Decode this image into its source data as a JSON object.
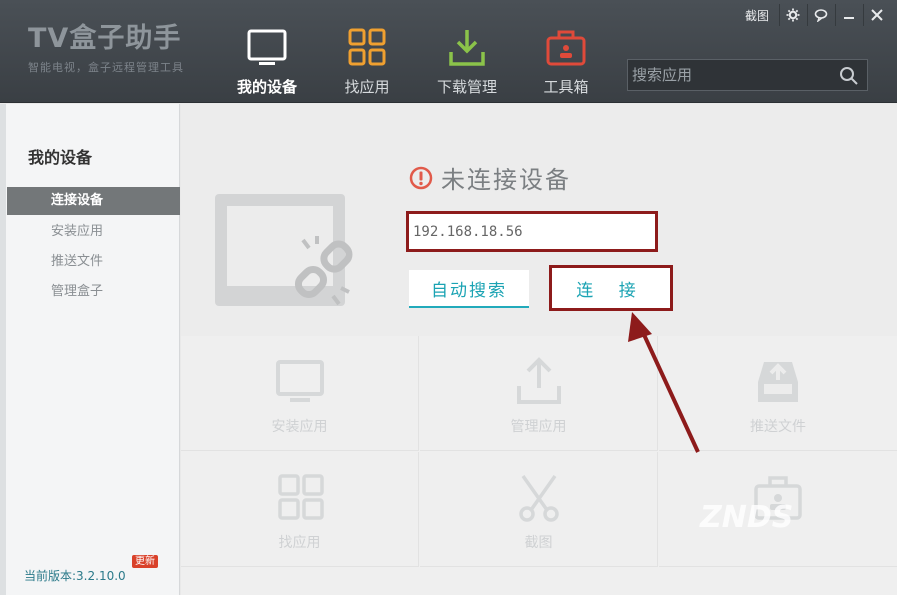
{
  "app": {
    "logo_title": "TV盒子助手",
    "logo_subtitle": "智能电视，盒子远程管理工具"
  },
  "nav": [
    {
      "label": "我的设备",
      "icon": "tv-icon",
      "active": true
    },
    {
      "label": "找应用",
      "icon": "apps-grid-icon",
      "active": false
    },
    {
      "label": "下载管理",
      "icon": "download-icon",
      "active": false
    },
    {
      "label": "工具箱",
      "icon": "toolbox-icon",
      "active": false
    }
  ],
  "search": {
    "placeholder": "搜索应用",
    "value": ""
  },
  "window": {
    "screenshot_label": "截图"
  },
  "sidebar": {
    "title": "我的设备",
    "items": [
      {
        "label": "连接设备",
        "active": true
      },
      {
        "label": "安装应用",
        "active": false
      },
      {
        "label": "推送文件",
        "active": false
      },
      {
        "label": "管理盒子",
        "active": false
      }
    ],
    "version": "当前版本:3.2.10.0",
    "update_badge": "更新"
  },
  "connect": {
    "status": "未连接设备",
    "ip_value": "192.168.18.56",
    "auto_search_label": "自动搜索",
    "connect_label": "连 接"
  },
  "tiles": [
    {
      "label": "安装应用",
      "icon": "monitor-icon"
    },
    {
      "label": "管理应用",
      "icon": "upload-icon"
    },
    {
      "label": "推送文件",
      "icon": "inbox-tray-icon"
    },
    {
      "label": "找应用",
      "icon": "apps-grid-icon"
    },
    {
      "label": "截图",
      "icon": "scissors-icon"
    },
    {
      "label": "",
      "icon": "toolbox-icon"
    }
  ],
  "watermark": "ZNDS",
  "colors": {
    "accent": "#1aa3b3",
    "highlight": "#8d1b1b",
    "nav_download": "#8bc34a",
    "nav_apps": "#f0a030",
    "nav_tools": "#e04a3a"
  }
}
